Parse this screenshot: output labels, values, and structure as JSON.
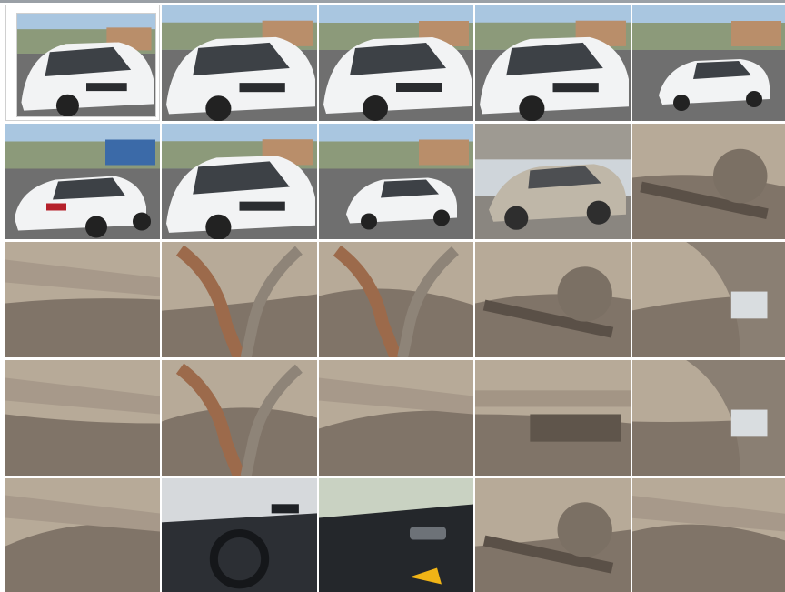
{
  "gallery": {
    "selected_index": 0,
    "columns": 5,
    "rows": 5,
    "photos": [
      {
        "scene": "white-sedan-front-three-quarter",
        "icon": "car-photo-icon"
      },
      {
        "scene": "white-sedan-front-three-quarter",
        "icon": "car-photo-icon"
      },
      {
        "scene": "white-sedan-front-three-quarter",
        "icon": "car-photo-icon"
      },
      {
        "scene": "white-sedan-front-three-quarter",
        "icon": "car-photo-icon"
      },
      {
        "scene": "white-sedan-front-right",
        "icon": "car-photo-icon"
      },
      {
        "scene": "white-sedan-rear-three-quarter",
        "icon": "car-photo-icon"
      },
      {
        "scene": "white-sedan-front-three-quarter",
        "icon": "car-photo-icon"
      },
      {
        "scene": "white-sedan-front-distant",
        "icon": "car-photo-icon"
      },
      {
        "scene": "dusty-sedan-front",
        "icon": "car-photo-icon"
      },
      {
        "scene": "wheel-arch-suspension",
        "icon": "undercarriage-photo-icon"
      },
      {
        "scene": "underbody-rear",
        "icon": "undercarriage-photo-icon"
      },
      {
        "scene": "underbody-exhaust-pipe",
        "icon": "undercarriage-photo-icon"
      },
      {
        "scene": "underbody-exhaust-pipe",
        "icon": "undercarriage-photo-icon"
      },
      {
        "scene": "underbody-suspension-arm",
        "icon": "undercarriage-photo-icon"
      },
      {
        "scene": "wheel-arch-liner",
        "icon": "undercarriage-photo-icon"
      },
      {
        "scene": "underbody-panel",
        "icon": "undercarriage-photo-icon"
      },
      {
        "scene": "exhaust-muffler-mount",
        "icon": "undercarriage-photo-icon"
      },
      {
        "scene": "underbody-sill",
        "icon": "undercarriage-photo-icon"
      },
      {
        "scene": "rear-axle-beam",
        "icon": "undercarriage-photo-icon"
      },
      {
        "scene": "wheel-arch-bracket",
        "icon": "undercarriage-photo-icon"
      },
      {
        "scene": "underbody-tank",
        "icon": "undercarriage-photo-icon"
      },
      {
        "scene": "interior-dashboard-steering",
        "icon": "interior-photo-icon"
      },
      {
        "scene": "interior-door-panel",
        "icon": "interior-photo-icon"
      },
      {
        "scene": "underbody-suspension-arm",
        "icon": "undercarriage-photo-icon"
      },
      {
        "scene": "underbody-panel",
        "icon": "undercarriage-photo-icon"
      }
    ]
  },
  "colors": {
    "background": "#ffffff",
    "sky": "#a9c6e0",
    "car_white": "#f2f3f4",
    "asphalt": "#6f6f6f",
    "under_dark": "#6e6258",
    "under_light": "#b7aa98",
    "rust": "#9c6a4b"
  }
}
